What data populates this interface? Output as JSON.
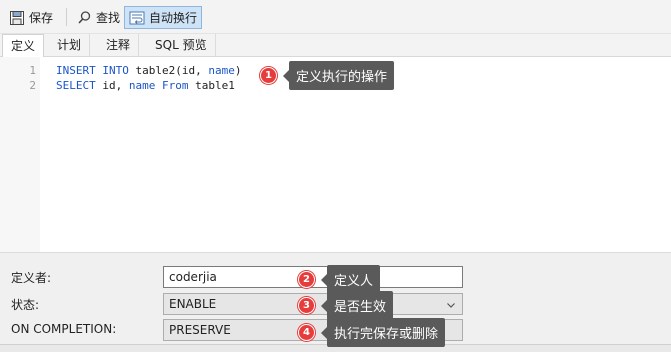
{
  "toolbar": {
    "save_label": "保存",
    "find_label": "查找",
    "wrap_label": "自动换行"
  },
  "tabs": [
    {
      "label": "定义",
      "active": true
    },
    {
      "label": "计划",
      "active": false
    },
    {
      "label": "注释",
      "active": false
    },
    {
      "label": "SQL 预览",
      "active": false
    }
  ],
  "editor": {
    "line_numbers": [
      "1",
      "2"
    ],
    "line1": {
      "kw1": "INSERT",
      "kw2": "INTO",
      "txt1": " table2(id, ",
      "kw3": "name",
      "txt2": ")"
    },
    "line2": {
      "kw1": "SELECT",
      "txt1": " id, ",
      "kw2": "name",
      "kw3": "From",
      "txt2": " table1"
    }
  },
  "annotations": [
    {
      "num": "1",
      "text": "定义执行的操作"
    },
    {
      "num": "2",
      "text": "定义人"
    },
    {
      "num": "3",
      "text": "是否生效"
    },
    {
      "num": "4",
      "text": "执行完保存或删除"
    }
  ],
  "form": {
    "definer_label": "定义者:",
    "definer_value": "coderjia",
    "status_label": "状态:",
    "status_value": "ENABLE",
    "completion_label": "ON COMPLETION:",
    "completion_value": "PRESERVE"
  },
  "colors": {
    "keyword": "#1a55c8",
    "badge": "#e63c3c",
    "callout": "#5a5a5a",
    "toolbar_active": "#cfe3f7"
  }
}
